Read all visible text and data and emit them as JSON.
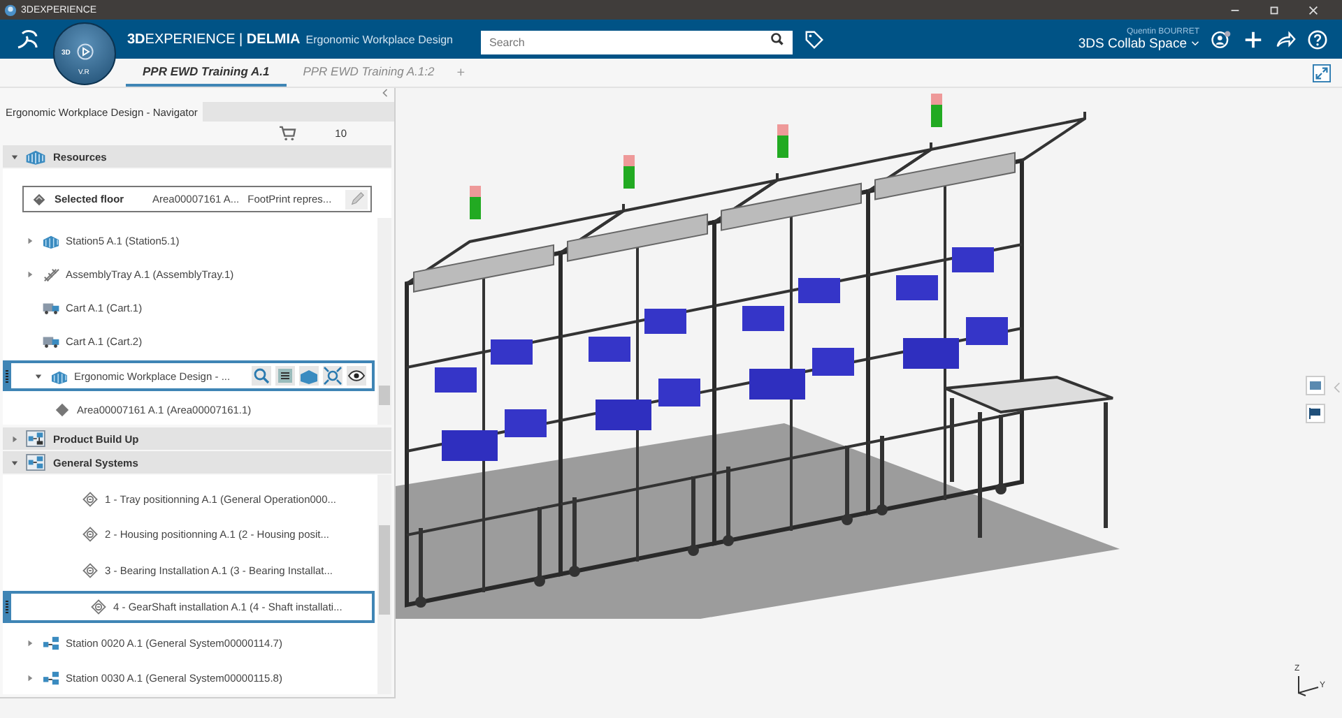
{
  "window": {
    "title": "3DEXPERIENCE"
  },
  "top_bar": {
    "brand": "**3D**EXPERIENCE | **DELMIA**",
    "app_name": "Ergonomic Workplace Design",
    "compass": {
      "left": "3D",
      "bottom": "V.R"
    },
    "search": {
      "placeholder": "Search"
    },
    "user": "Quentin BOURRET",
    "space": "3DS Collab Space"
  },
  "tabs": [
    {
      "label": "PPR EWD Training A.1",
      "selected": true
    },
    {
      "label": "PPR EWD Training A.1:2",
      "selected": false
    }
  ],
  "add_tab": "+",
  "navigator": {
    "title": "Ergonomic Workplace Design - Navigator",
    "count": "10",
    "sections": [
      {
        "label": "Resources",
        "kind": "resources",
        "expanded": true,
        "selected_floor": {
          "label": "Selected floor",
          "area": "Area00007161 A...",
          "representation": "FootPrint repres..."
        },
        "items": [
          {
            "label": "Station5 A.1 (Station5.1)",
            "kind": "station",
            "expanded": false,
            "selected": false
          },
          {
            "label": "AssemblyTray A.1 (AssemblyTray.1)",
            "kind": "tray",
            "expanded": false,
            "selected": false
          },
          {
            "label": "Cart A.1 (Cart.1)",
            "kind": "cart",
            "selected": false
          },
          {
            "label": "Cart A.1 (Cart.2)",
            "kind": "cart",
            "selected": false
          },
          {
            "label": "Ergonomic Workplace Design - ...",
            "kind": "station",
            "expanded": true,
            "selected": true,
            "children": [
              {
                "label": "Area00007161 A.1 (Area00007161.1)",
                "kind": "area",
                "selected": false
              }
            ]
          }
        ]
      },
      {
        "label": "Product Build Up",
        "kind": "product",
        "expanded": false
      },
      {
        "label": "General Systems",
        "kind": "system",
        "expanded": true,
        "items": [
          {
            "label": "1 - Tray positionning A.1 (General Operation000...",
            "kind": "operation",
            "selected": false
          },
          {
            "label": "2 - Housing positionning A.1 (2 - Housing posit...",
            "kind": "operation",
            "selected": false
          },
          {
            "label": "3 - Bearing Installation A.1 (3 - Bearing Installat...",
            "kind": "operation",
            "selected": false
          },
          {
            "label": "4 - GearShaft installation A.1 (4 - Shaft installati...",
            "kind": "operation",
            "selected": true
          },
          {
            "label": "Station 0020 A.1 (General System00000114.7)",
            "kind": "system",
            "expanded": false,
            "selected": false
          },
          {
            "label": "Station 0030 A.1 (General System00000115.8)",
            "kind": "system",
            "expanded": false,
            "selected": false
          }
        ]
      }
    ]
  },
  "viewport": {
    "triad": {
      "z": "Z",
      "y": "Y"
    }
  }
}
